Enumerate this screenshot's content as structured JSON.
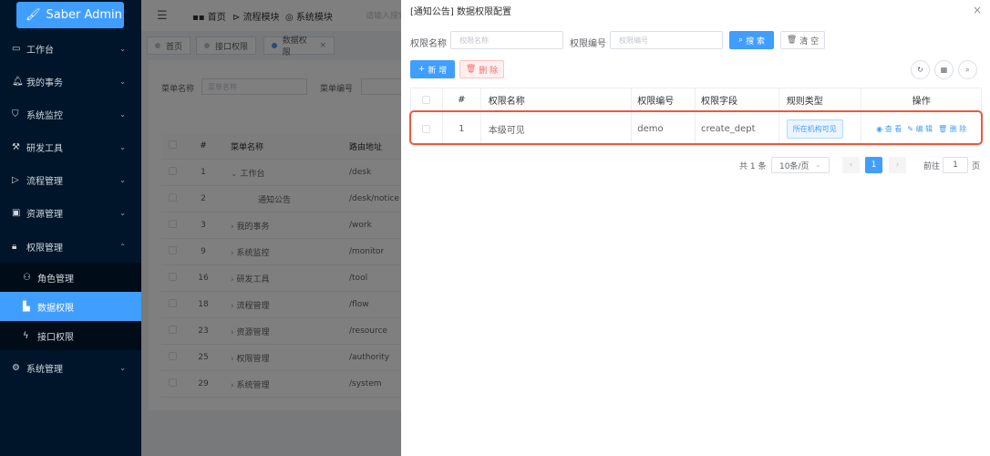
{
  "app": {
    "title": "Saber Admin"
  },
  "sidebar": {
    "items": [
      {
        "label": "工作台",
        "icon": "monitor-icon"
      },
      {
        "label": "我的事务",
        "icon": "bell-icon"
      },
      {
        "label": "系统监控",
        "icon": "shield-icon"
      },
      {
        "label": "研发工具",
        "icon": "wrench-icon"
      },
      {
        "label": "流程管理",
        "icon": "send-icon"
      },
      {
        "label": "资源管理",
        "icon": "folder-icon"
      },
      {
        "label": "权限管理",
        "icon": "lock-icon"
      },
      {
        "label": "系统管理",
        "icon": "gear-icon"
      }
    ],
    "submenu": [
      {
        "label": "角色管理",
        "icon": "user-icon"
      },
      {
        "label": "数据权限",
        "icon": "chart-icon"
      },
      {
        "label": "接口权限",
        "icon": "plug-icon"
      }
    ]
  },
  "topbar": {
    "nav": [
      "首页",
      "流程模块",
      "系统模块"
    ],
    "search_placeholder": "请输入搜索"
  },
  "tabs": [
    "首页",
    "接口权限",
    "数据权限"
  ],
  "background": {
    "search": {
      "label1": "菜单名称",
      "placeholder1": "菜单名称",
      "label2": "菜单编号"
    },
    "columns": [
      "#",
      "菜单名称",
      "路由地址"
    ],
    "rows": [
      {
        "idx": "1",
        "name": "工作台",
        "path": "/desk"
      },
      {
        "idx": "2",
        "name": "通知公告",
        "path": "/desk/notice"
      },
      {
        "idx": "3",
        "name": "我的事务",
        "path": "/work"
      },
      {
        "idx": "9",
        "name": "系统监控",
        "path": "/monitor"
      },
      {
        "idx": "16",
        "name": "研发工具",
        "path": "/tool"
      },
      {
        "idx": "18",
        "name": "流程管理",
        "path": "/flow"
      },
      {
        "idx": "23",
        "name": "资源管理",
        "path": "/resource"
      },
      {
        "idx": "25",
        "name": "权限管理",
        "path": "/authority"
      },
      {
        "idx": "29",
        "name": "系统管理",
        "path": "/system"
      }
    ]
  },
  "drawer": {
    "title": "[通知公告] 数据权限配置",
    "search": {
      "name_label": "权限名称",
      "name_placeholder": "权限名称",
      "code_label": "权限编号",
      "code_placeholder": "权限编号",
      "search_btn": "搜 索",
      "clear_btn": "清 空"
    },
    "toolbar": {
      "add_btn": "新 增",
      "delete_btn": "删 除"
    },
    "columns": [
      "#",
      "权限名称",
      "权限编号",
      "权限字段",
      "规则类型",
      "操作"
    ],
    "rows": [
      {
        "idx": "1",
        "name": "本级可见",
        "code": "demo",
        "field": "create_dept",
        "type": "所在机构可见",
        "view": "查 看",
        "edit": "编 辑",
        "del": "删 除"
      }
    ],
    "pagination": {
      "total": "共 1 条",
      "page_size": "10条/页",
      "current": "1",
      "goto_label": "前往",
      "goto_value": "1",
      "page_unit": "页"
    }
  }
}
